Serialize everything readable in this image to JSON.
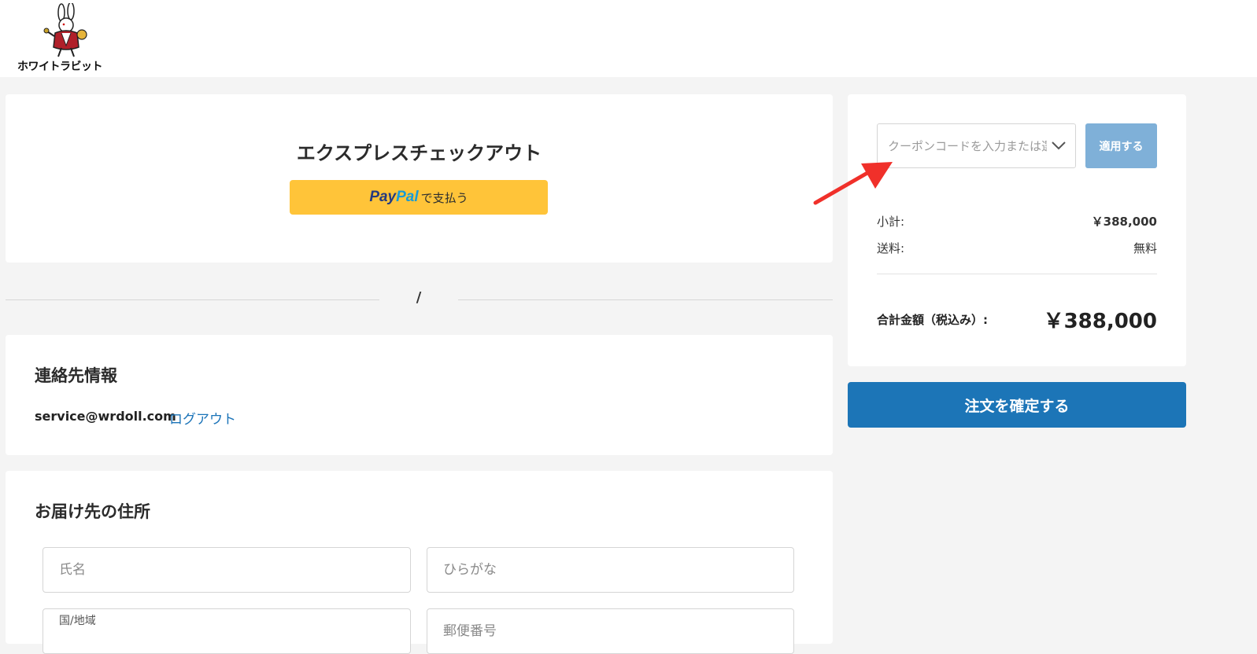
{
  "brand": {
    "logo_text": "ホワイトラビット"
  },
  "express": {
    "title": "エクスプレスチェックアウト",
    "paypal_pay": "Pay",
    "paypal_pal": "Pal",
    "paypal_suffix": "で支払う"
  },
  "divider": {
    "text": "/"
  },
  "contact": {
    "title": "連絡先情報",
    "email": "service@wrdoll.com",
    "logout_label": "ログアウト"
  },
  "address": {
    "title": "お届け先の住所",
    "name_placeholder": "氏名",
    "kana_placeholder": "ひらがな",
    "country_label": "国/地域",
    "postal_placeholder": "郵便番号"
  },
  "summary": {
    "coupon_placeholder": "クーポンコードを入力または選択",
    "apply_label": "適用する",
    "subtotal_label": "小計:",
    "subtotal_value": "￥388,000",
    "shipping_label": "送料:",
    "shipping_value": "無料",
    "total_label": "合計金額（税込み）:",
    "total_value": "￥388,000"
  },
  "actions": {
    "confirm_label": "注文を確定する"
  },
  "colors": {
    "paypal_button": "#ffc439",
    "apply_button": "#7fb0d8",
    "confirm_button": "#1c75b7",
    "link": "#1a73b8",
    "annotation_arrow": "#f0302a"
  }
}
